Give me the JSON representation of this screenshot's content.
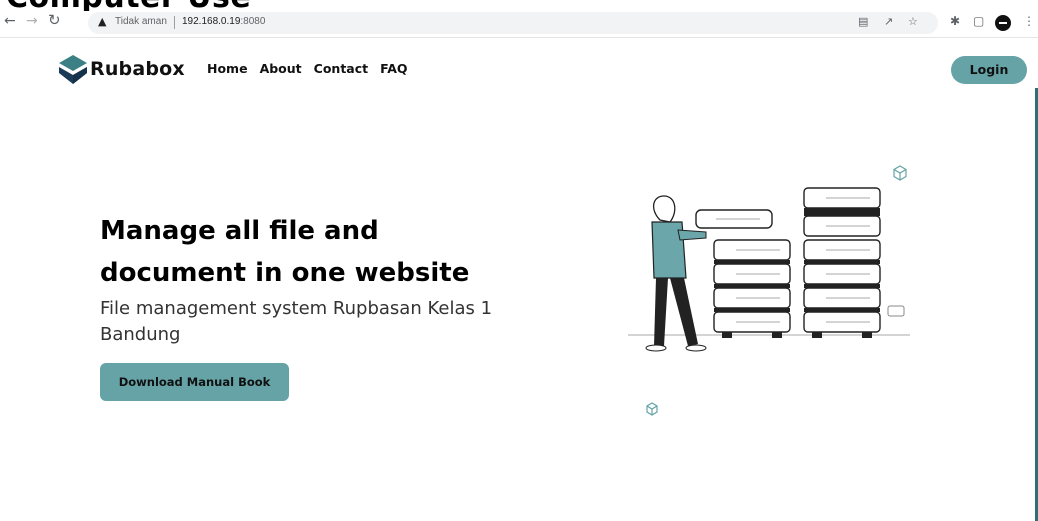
{
  "cropped_heading": "Computer Use",
  "browser": {
    "back_icon": "arrow-left-icon",
    "forward_icon": "arrow-right-icon",
    "reload_icon": "reload-icon",
    "warning_icon": "warning-icon",
    "security_text": "Tidak aman",
    "url_host": "192.168.0.19",
    "url_port": ":8080",
    "translate_icon": "translate-icon",
    "share_icon": "share-icon",
    "bookmark_icon": "star-icon",
    "extensions_icon": "puzzle-icon",
    "sidebar_icon": "sidebar-icon",
    "profile_icon": "avatar-icon",
    "menu_icon": "kebab-menu-icon"
  },
  "nav": {
    "brand": "Rubabox",
    "links": [
      "Home",
      "About",
      "Contact",
      "FAQ"
    ],
    "login_label": "Login"
  },
  "hero": {
    "title_line1": "Manage all file and",
    "title_line2": "document in one website",
    "subtitle": "File management system Rupbasan Kelas 1 Bandung",
    "button_label": "Download Manual Book"
  },
  "colors": {
    "accent": "#65a3a7",
    "text": "#111111"
  }
}
